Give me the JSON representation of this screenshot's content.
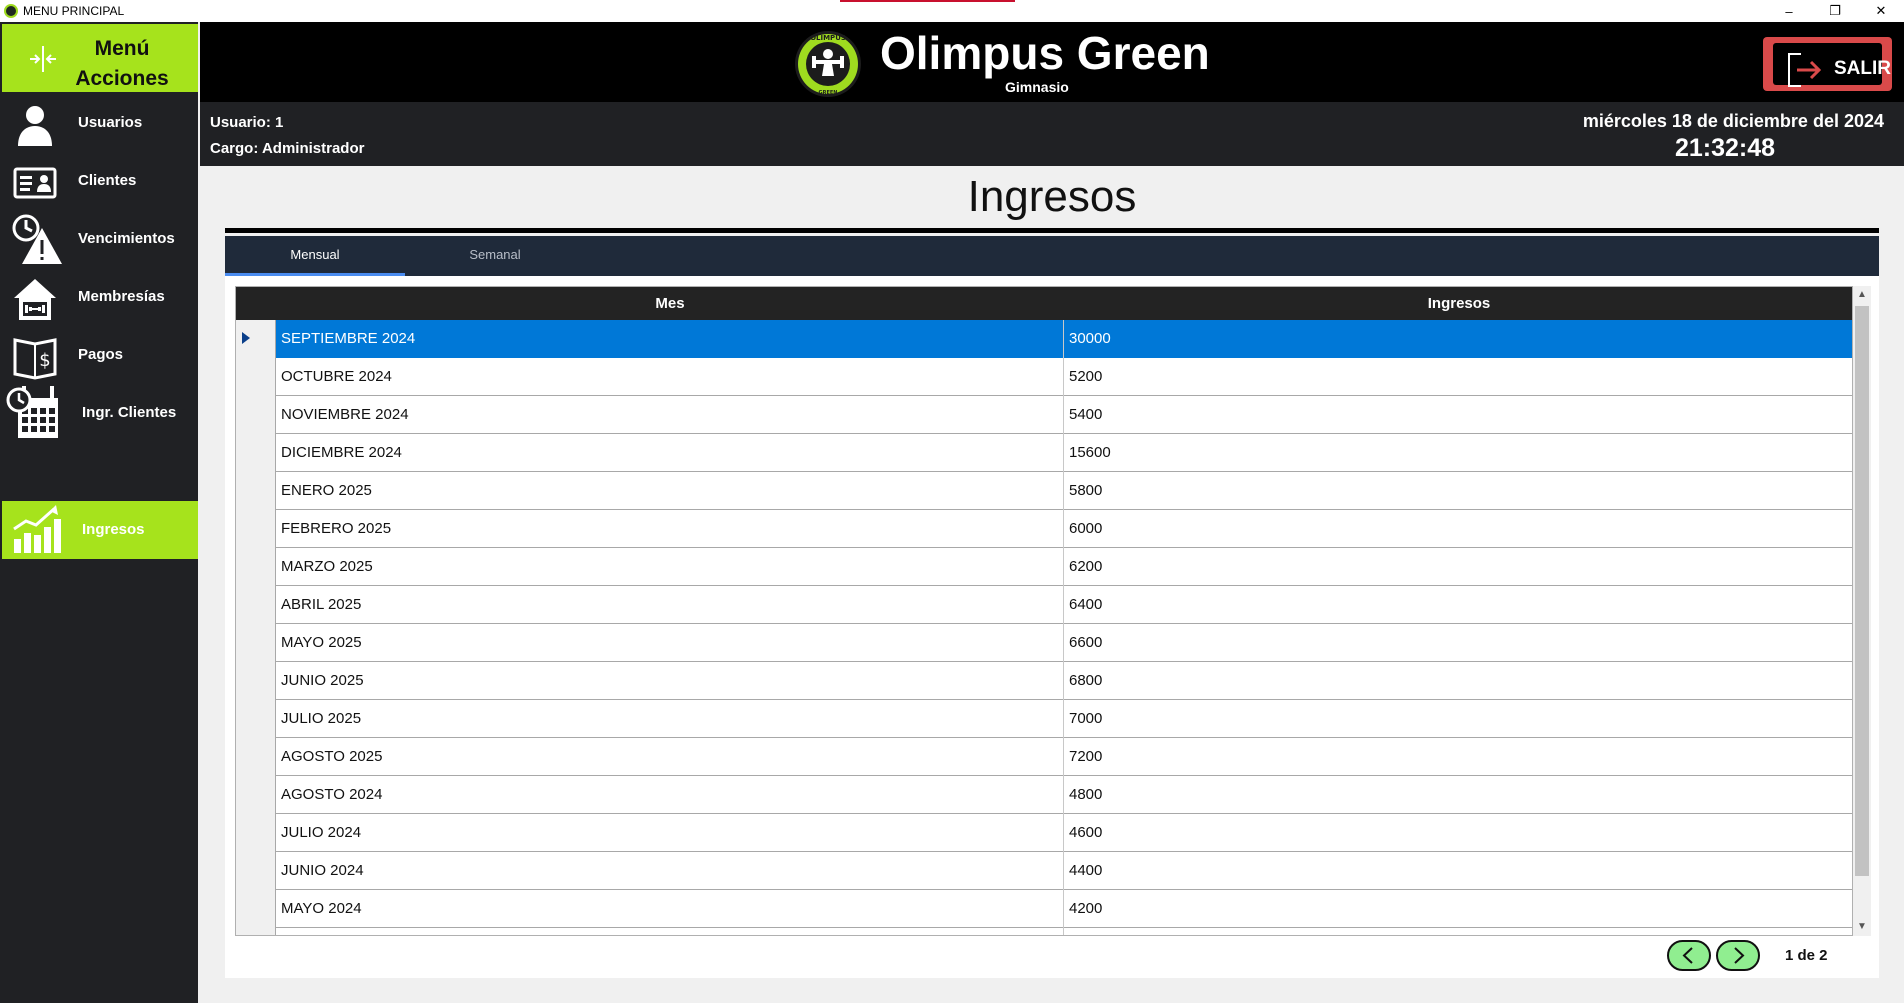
{
  "window": {
    "title": "MENU PRINCIPAL",
    "controls": {
      "minimize": "–",
      "maximize": "❐",
      "close": "✕"
    }
  },
  "sidebar": {
    "header": "Menú\nAcciones",
    "items": [
      {
        "label": "Usuarios",
        "icon": "user-icon"
      },
      {
        "label": "Clientes",
        "icon": "id-card-icon"
      },
      {
        "label": "Vencimientos",
        "icon": "clock-warning-icon"
      },
      {
        "label": "Membresías",
        "icon": "gym-house-icon"
      },
      {
        "label": "Pagos",
        "icon": "payment-book-icon"
      },
      {
        "label": "Ingr. Clientes",
        "icon": "calendar-clock-icon"
      },
      {
        "label": "Ingresos",
        "icon": "chart-growth-icon",
        "active": true
      }
    ]
  },
  "header": {
    "brand": "Olimpus Green",
    "subtitle": "Gimnasio",
    "logo_text_top": "OLIMPUS",
    "logo_text_bottom": "GREEN",
    "exit_label": "SALIR"
  },
  "session": {
    "user": "Usuario: 1",
    "role": "Cargo: Administrador",
    "date": "miércoles 18 de diciembre del 2024",
    "time": "21:32:48"
  },
  "page": {
    "title": "Ingresos",
    "tabs": [
      {
        "label": "Mensual",
        "active": true
      },
      {
        "label": "Semanal",
        "active": false
      }
    ]
  },
  "table": {
    "columns": [
      "Mes",
      "Ingresos"
    ],
    "selected_index": 0,
    "rows": [
      [
        "SEPTIEMBRE 2024",
        "30000"
      ],
      [
        "OCTUBRE 2024",
        "5200"
      ],
      [
        "NOVIEMBRE 2024",
        "5400"
      ],
      [
        "DICIEMBRE 2024",
        "15600"
      ],
      [
        "ENERO 2025",
        "5800"
      ],
      [
        "FEBRERO 2025",
        "6000"
      ],
      [
        "MARZO 2025",
        "6200"
      ],
      [
        "ABRIL 2025",
        "6400"
      ],
      [
        "MAYO 2025",
        "6600"
      ],
      [
        "JUNIO 2025",
        "6800"
      ],
      [
        "JULIO 2025",
        "7000"
      ],
      [
        "AGOSTO 2025",
        "7200"
      ],
      [
        "AGOSTO 2024",
        "4800"
      ],
      [
        "JULIO 2024",
        "4600"
      ],
      [
        "JUNIO 2024",
        "4400"
      ],
      [
        "MAYO 2024",
        "4200"
      ],
      [
        "",
        ""
      ]
    ]
  },
  "pagination": {
    "indicator": "1 de 2"
  },
  "colors": {
    "accent_green": "#a6e31c",
    "header_black": "#000000",
    "sidebar_dark": "#202124",
    "selection_blue": "#0078d7",
    "exit_red": "#d94a4a",
    "pager_green": "#90ee90"
  }
}
